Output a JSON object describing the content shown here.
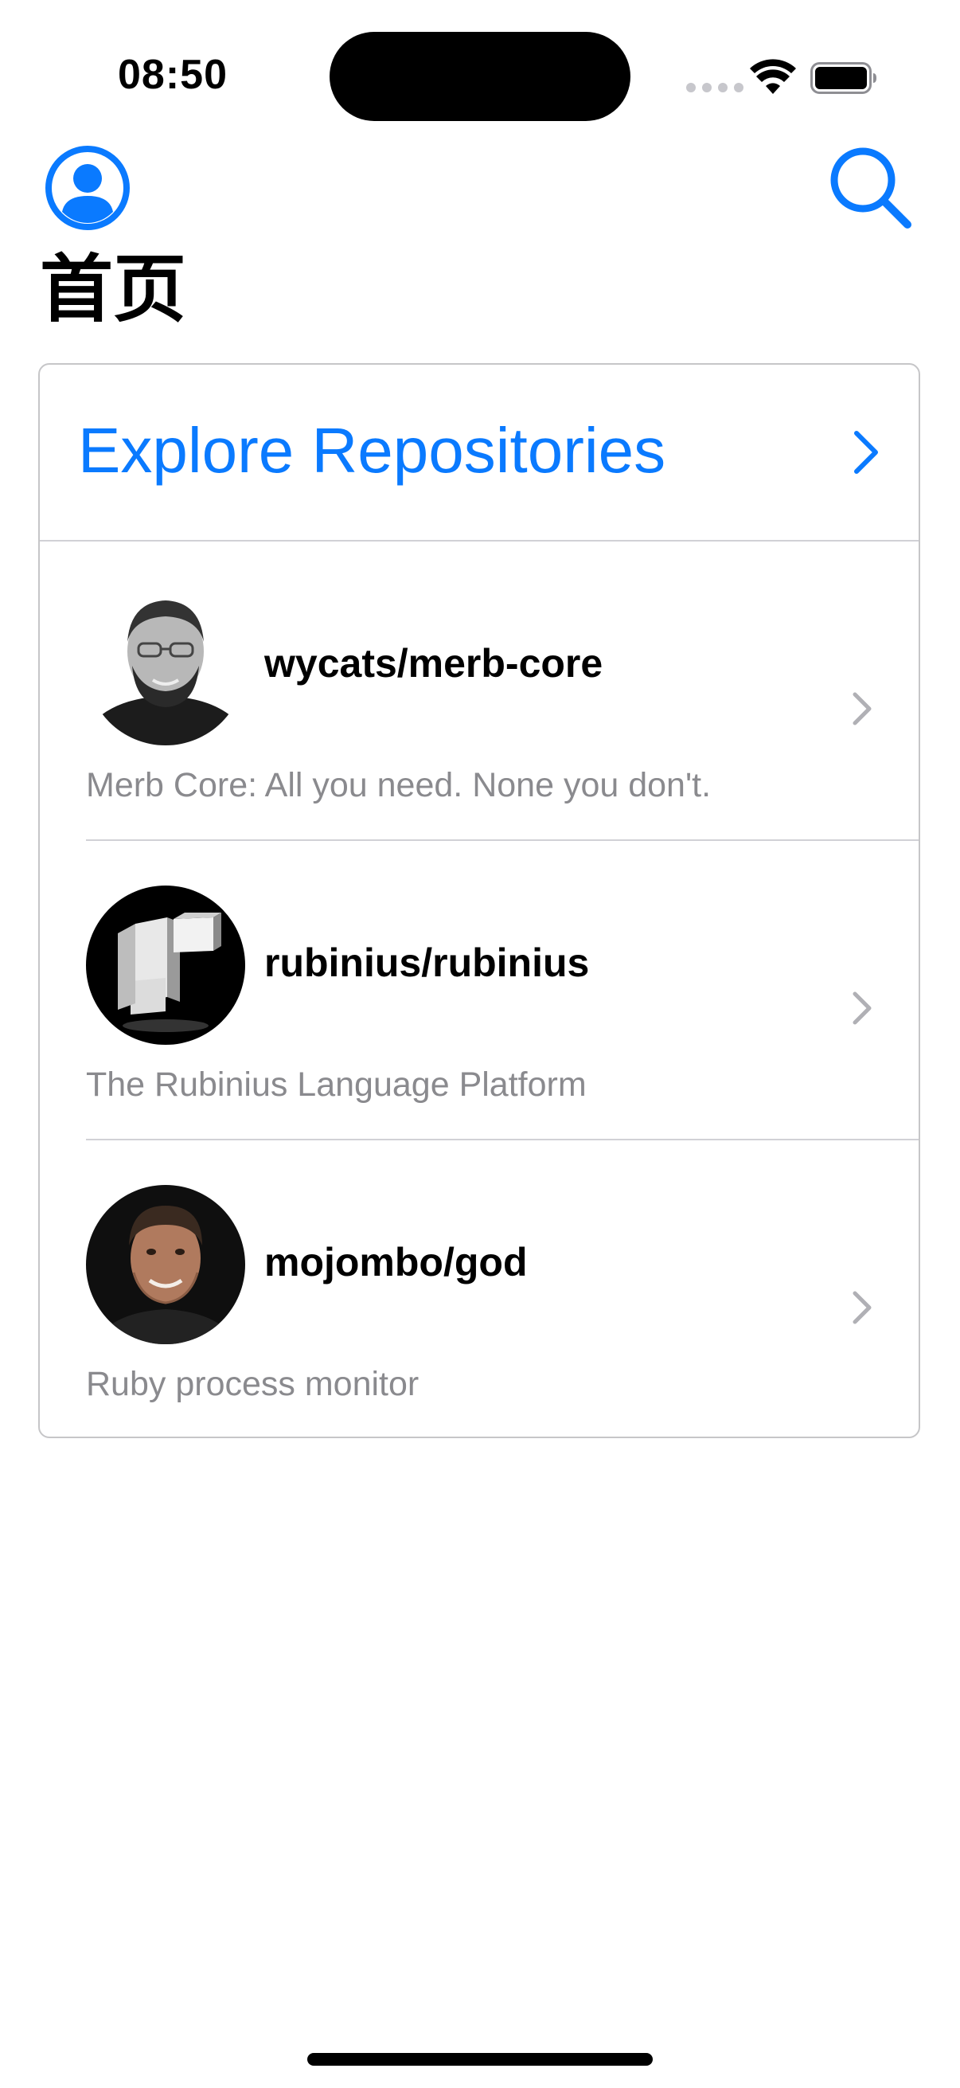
{
  "status_bar": {
    "time": "08:50"
  },
  "nav": {
    "profile_icon": "person-circle-icon",
    "search_icon": "magnifying-glass-icon",
    "title": "首页"
  },
  "explore": {
    "label": "Explore Repositories"
  },
  "repositories": [
    {
      "name": "wycats/merb-core",
      "description": "Merb Core: All you need. None you don't."
    },
    {
      "name": "rubinius/rubinius",
      "description": "The Rubinius Language Platform"
    },
    {
      "name": "mojombo/god",
      "description": "Ruby process monitor"
    }
  ],
  "colors": {
    "accent": "#0a7aff",
    "secondary_text": "#8a8a8e",
    "separator": "#d1d1d6"
  }
}
